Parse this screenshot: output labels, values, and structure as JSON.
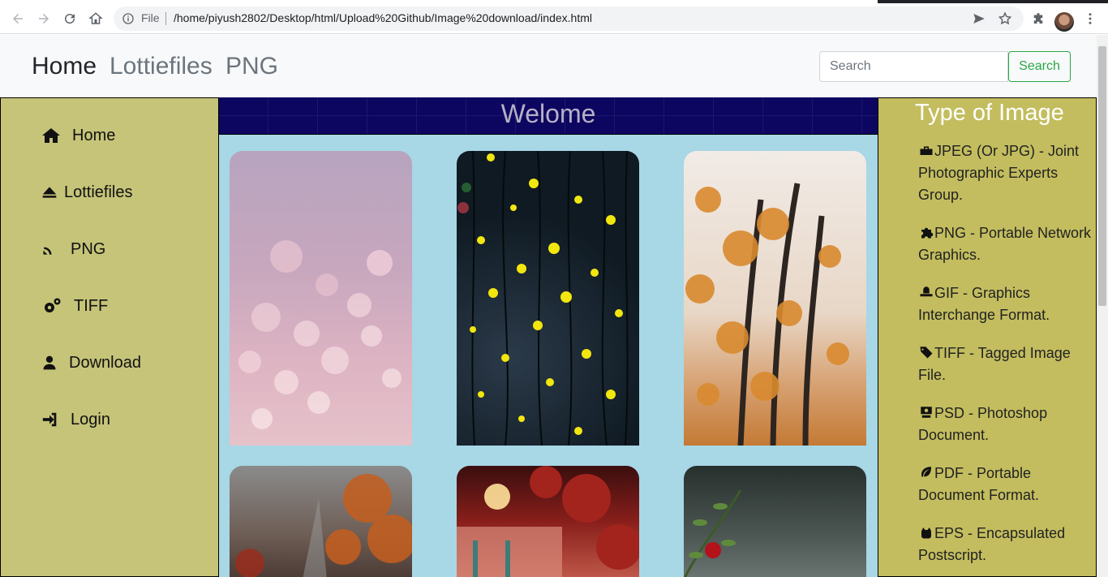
{
  "browser": {
    "file_label": "File",
    "url": "/home/piyush2802/Desktop/html/Upload%20Github/Image%20download/index.html"
  },
  "navbar": {
    "brand": "Home",
    "links": [
      "Lottiefiles",
      "PNG"
    ],
    "search_placeholder": "Search",
    "search_button": "Search"
  },
  "sidebar": {
    "items": [
      {
        "label": "Home",
        "icon": "home-icon"
      },
      {
        "label": "Lottiefiles",
        "icon": "eject-icon"
      },
      {
        "label": "PNG",
        "icon": "satellite-dish-icon"
      },
      {
        "label": "TIFF",
        "icon": "gears-icon"
      },
      {
        "label": "Download",
        "icon": "user-icon"
      },
      {
        "label": "Login",
        "icon": "sign-in-icon"
      }
    ]
  },
  "main": {
    "welcome": "Welome"
  },
  "rightbar": {
    "title": "Type of Image",
    "items": [
      {
        "text": "JPEG (Or JPG) - Joint Photographic Experts Group.",
        "icon": "tools-icon"
      },
      {
        "text": "PNG - Portable Network Graphics.",
        "icon": "puzzle-icon"
      },
      {
        "text": "GIF - Graphics Interchange Format.",
        "icon": "hat-icon"
      },
      {
        "text": "TIFF - Tagged Image File.",
        "icon": "tags-icon"
      },
      {
        "text": "PSD - Photoshop Document.",
        "icon": "teacher-icon"
      },
      {
        "text": "PDF - Portable Document Format.",
        "icon": "leaf-icon"
      },
      {
        "text": "EPS - Encapsulated Postscript.",
        "icon": "cat-icon"
      }
    ]
  },
  "colors": {
    "sidebar": "#c6c479",
    "center": "#a8d7e6",
    "welcome_bar": "#0d0660",
    "rightbar": "#c3bd5f",
    "search_accent": "#28a745"
  }
}
